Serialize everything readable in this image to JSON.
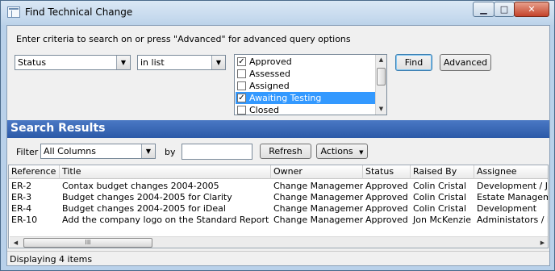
{
  "window": {
    "title": "Find Technical Change",
    "min_glyph": "▁",
    "max_glyph": "□",
    "close_glyph": "✕"
  },
  "criteria": {
    "instruction": "Enter criteria to search on or press \"Advanced\" for advanced query options",
    "field_value": "Status",
    "operator_value": "in list",
    "options": [
      {
        "label": "Approved",
        "checked": true,
        "selected": false
      },
      {
        "label": "Assessed",
        "checked": false,
        "selected": false
      },
      {
        "label": "Assigned",
        "checked": false,
        "selected": false
      },
      {
        "label": "Awaiting Testing",
        "checked": true,
        "selected": true
      },
      {
        "label": "Closed",
        "checked": false,
        "selected": false
      }
    ],
    "find_label": "Find",
    "advanced_label": "Advanced"
  },
  "results": {
    "heading": "Search Results",
    "filter_label": "Filter",
    "filter_value": "All Columns",
    "by_label": "by",
    "by_value": "",
    "refresh_label": "Refresh",
    "actions_label": "Actions",
    "actions_glyph": "▼"
  },
  "grid": {
    "columns": [
      "Reference",
      "Title",
      "Owner",
      "Status",
      "Raised By",
      "Assignee"
    ],
    "rows": [
      [
        "ER-2",
        "Contax budget changes 2004-2005",
        "Change Management",
        "Approved",
        "Colin Cristal",
        "Development / Jon"
      ],
      [
        "ER-3",
        "Budget changes 2004-2005 for Clarity",
        "Change Management",
        "Approved",
        "Colin Cristal",
        "Estate Management"
      ],
      [
        "ER-4",
        "Budget changes 2004-2005 for iDeal",
        "Change Management",
        "Approved",
        "Colin Cristal",
        "Development"
      ],
      [
        "ER-10",
        "Add the company logo on the Standard Report footer",
        "Change Management",
        "Approved",
        "Jon McKenzie",
        "Administators / Prod"
      ]
    ],
    "scroll_grip": "III"
  },
  "status_text": "Displaying 4 items",
  "icons": {
    "dropdown": "▼",
    "scroll_up": "▲",
    "scroll_down": "▼",
    "scroll_left": "◀",
    "scroll_right": "▶",
    "check": "✓"
  },
  "colors": {
    "results_header": "#2c5aa8",
    "selection": "#3399ff"
  }
}
